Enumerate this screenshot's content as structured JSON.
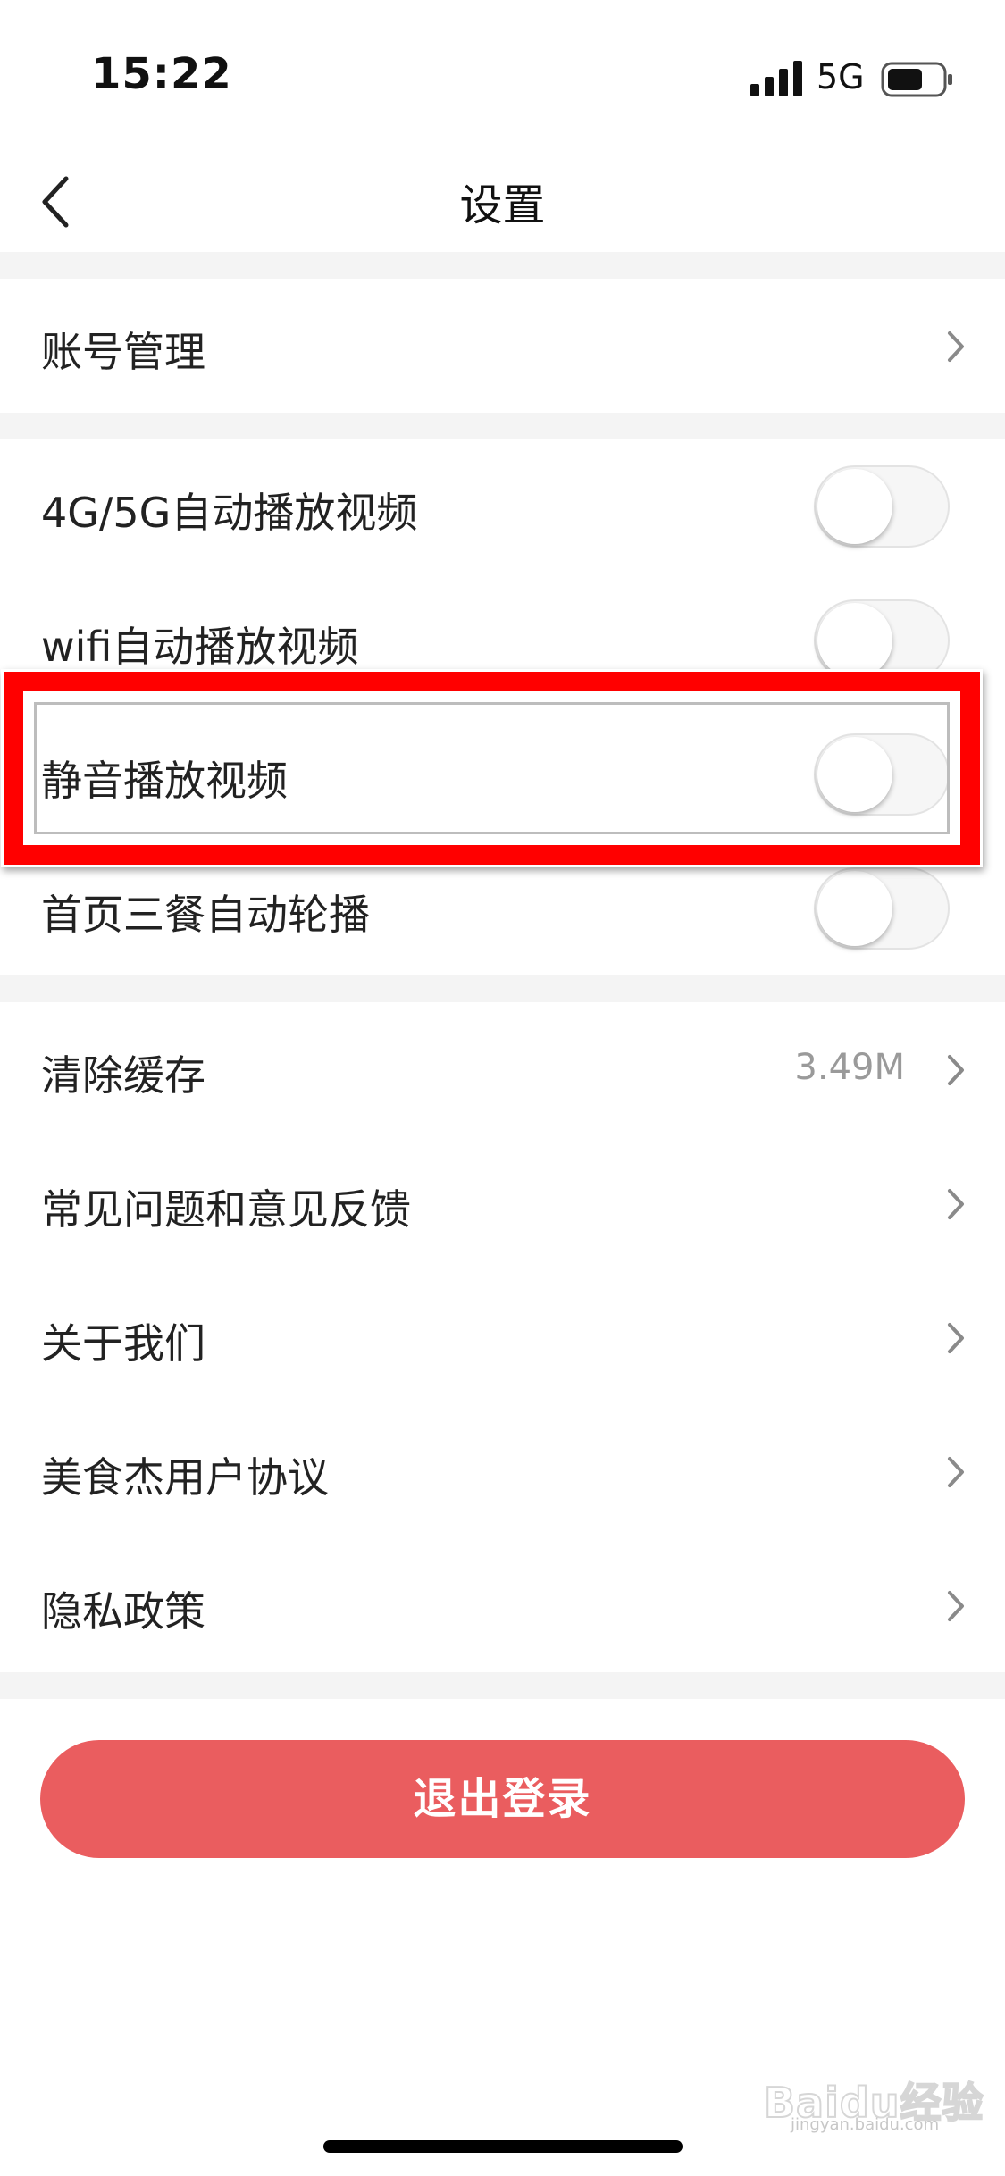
{
  "status_bar": {
    "time": "15:22",
    "network": "5G",
    "signal_icon": "signal-bars-icon",
    "battery_icon": "battery-icon"
  },
  "nav": {
    "title": "设置",
    "back_icon": "chevron-left-icon"
  },
  "account_section": {
    "account_label": "账号管理"
  },
  "toggle_section": {
    "items": [
      {
        "label": "4G/5G自动播放视频",
        "on": false
      },
      {
        "label": "wifi自动播放视频",
        "on": false
      },
      {
        "label": "静音播放视频",
        "on": false,
        "highlighted": true
      },
      {
        "label": "首页三餐自动轮播",
        "on": false
      }
    ]
  },
  "link_section": {
    "items": [
      {
        "label": "清除缓存",
        "value": "3.49M"
      },
      {
        "label": "常见问题和意见反馈"
      },
      {
        "label": "关于我们"
      },
      {
        "label": "美食杰用户协议"
      },
      {
        "label": "隐私政策"
      }
    ]
  },
  "logout_label": "退出登录",
  "watermark": {
    "text": "Baidu经验",
    "sub": "jingyan.baidu.com"
  },
  "colors": {
    "accent": "#ea5d5f",
    "highlight": "#ff0000",
    "section_gap": "#f4f4f4"
  }
}
